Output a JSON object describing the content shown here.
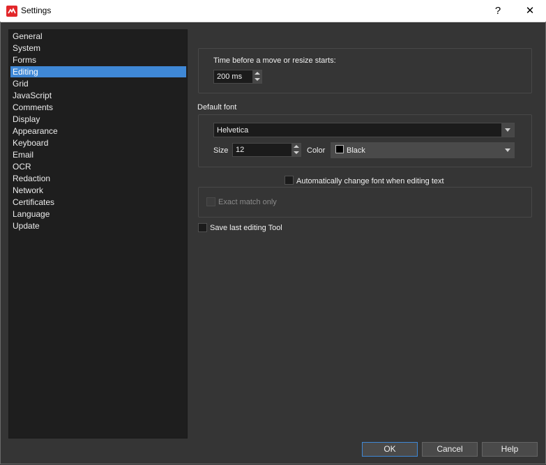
{
  "window": {
    "title": "Settings",
    "help_glyph": "?",
    "close_glyph": "✕"
  },
  "sidebar": {
    "items": [
      {
        "label": "General"
      },
      {
        "label": "System"
      },
      {
        "label": "Forms"
      },
      {
        "label": "Editing"
      },
      {
        "label": "Grid"
      },
      {
        "label": "JavaScript"
      },
      {
        "label": "Comments"
      },
      {
        "label": "Display"
      },
      {
        "label": "Appearance"
      },
      {
        "label": "Keyboard"
      },
      {
        "label": "Email"
      },
      {
        "label": "OCR"
      },
      {
        "label": "Redaction"
      },
      {
        "label": "Network"
      },
      {
        "label": "Certificates"
      },
      {
        "label": "Language"
      },
      {
        "label": "Update"
      }
    ],
    "selected": "Editing"
  },
  "editing": {
    "move_delay_label": "Time before a move or resize starts:",
    "move_delay_value": "200 ms",
    "default_font_heading": "Default font",
    "font_family": "Helvetica",
    "size_label": "Size",
    "size_value": "12",
    "color_label": "Color",
    "color_value": "Black",
    "color_swatch": "#000000",
    "auto_change_font_label": "Automatically change font when editing text",
    "auto_change_font_checked": false,
    "exact_match_label": "Exact match only",
    "exact_match_checked": false,
    "exact_match_enabled": false,
    "save_last_tool_label": "Save last editing Tool",
    "save_last_tool_checked": false
  },
  "buttons": {
    "ok": "OK",
    "cancel": "Cancel",
    "help": "Help"
  },
  "colors": {
    "accent": "#3f88d6",
    "background": "#353535",
    "sidebar": "#1e1e1e"
  }
}
